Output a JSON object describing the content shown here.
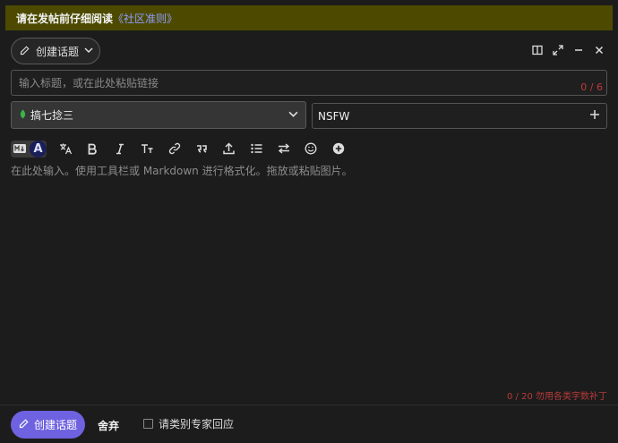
{
  "notice": {
    "prefix": "请在发帖前仔细阅读",
    "link": "《社区准则》"
  },
  "header": {
    "action_label": "创建话题",
    "action_icon": "pencil-icon",
    "window_controls": [
      "toggle-preview-icon",
      "fullscreen-icon",
      "minimize-icon",
      "close-icon"
    ]
  },
  "title": {
    "placeholder": "输入标题，或在此处粘贴链接",
    "value": "",
    "counter": "0 / 6"
  },
  "category": {
    "selected": "搞七捻三",
    "color": "#3ab54a"
  },
  "tags": {
    "selected": "NSFW"
  },
  "toolbar": {
    "mode_rich_label": "A",
    "buttons": [
      "translate-icon",
      "bold-icon",
      "italic-icon",
      "heading-icon",
      "link-icon",
      "quote-icon",
      "upload-icon",
      "list-icon",
      "swap-icon",
      "emoji-icon",
      "plus-circle-icon"
    ]
  },
  "editor": {
    "placeholder": "在此处输入。使用工具栏或 Markdown 进行格式化。拖放或粘贴图片。",
    "value": "",
    "counter": "0 / 20 勿用各类字数补丁"
  },
  "footer": {
    "submit_label": "创建话题",
    "discard_label": "舍弃",
    "expert_label": "请类别专家回应",
    "expert_checked": false
  },
  "colors": {
    "accent": "#6f62e0",
    "notice_bg": "#4d4a00",
    "error": "#c23a3a"
  }
}
